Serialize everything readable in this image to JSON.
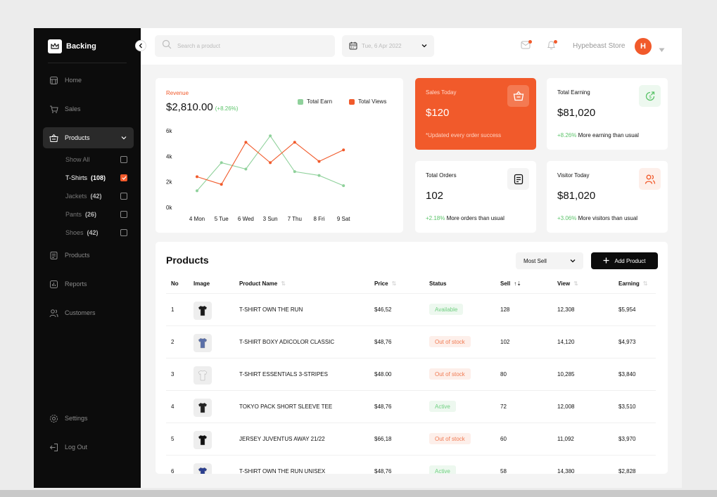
{
  "sidebar": {
    "brand": "Backing",
    "nav": {
      "home": "Home",
      "sales": "Sales",
      "products": "Products",
      "products2": "Products",
      "reports": "Reports",
      "customers": "Customers",
      "settings": "Settings",
      "logout": "Log Out"
    },
    "subitems": [
      {
        "label": "Show All",
        "count": "",
        "checked": false
      },
      {
        "label": "T-Shirts",
        "count": "(108)",
        "checked": true
      },
      {
        "label": "Jackets",
        "count": "(42)",
        "checked": false
      },
      {
        "label": "Pants",
        "count": "(26)",
        "checked": false
      },
      {
        "label": "Shoes",
        "count": "(42)",
        "checked": false
      }
    ]
  },
  "topbar": {
    "search_placeholder": "Search a product",
    "date": "Tue, 6 Apr 2022",
    "store": "Hypebeast Store",
    "avatar_initial": "H"
  },
  "revenue": {
    "label": "Revenue",
    "value": "$2,810.00",
    "change": "(+8.26%)"
  },
  "chart_data": {
    "type": "line",
    "x": [
      "4 Mon",
      "5 Tue",
      "6 Wed",
      "3 Sun",
      "7 Thu",
      "8 Fri",
      "9 Sat"
    ],
    "y_ticks": [
      "6k",
      "4k",
      "2k",
      "0k"
    ],
    "ylim": [
      0,
      6000
    ],
    "grid": false,
    "legend": "top-right",
    "series": [
      {
        "name": "Total Earn",
        "color": "#8fd19b",
        "values": [
          1300,
          3500,
          3000,
          5600,
          2800,
          2500,
          1700
        ]
      },
      {
        "name": "Total Views",
        "color": "#f15a2b",
        "values": [
          2400,
          1800,
          5100,
          3500,
          5100,
          3600,
          4500
        ]
      }
    ]
  },
  "stats": {
    "sales_today": {
      "title": "Sales Today",
      "value": "$120",
      "note": "*Updated every order success"
    },
    "total_earning": {
      "title": "Total Earning",
      "value": "$81,020",
      "change": "+8.26%",
      "note": "More earning than usual"
    },
    "total_orders": {
      "title": "Total Orders",
      "value": "102",
      "change": "+2.18%",
      "note": "More orders than usual"
    },
    "visitor_today": {
      "title": "Visitor Today",
      "value": "$81,020",
      "change": "+3.06%",
      "note": "More visitors than usual"
    }
  },
  "products": {
    "title": "Products",
    "sort_label": "Most Sell",
    "add_label": "Add Product",
    "columns": [
      "No",
      "Image",
      "Product Name",
      "Price",
      "Status",
      "Sell",
      "View",
      "Earning"
    ],
    "rows": [
      {
        "no": "1",
        "name": "T-SHIRT OWN THE RUN",
        "price": "$46,52",
        "status": "Available",
        "sell": "128",
        "view": "12,308",
        "earning": "$5,954",
        "tone": "green",
        "shirt": "#1a1a1a"
      },
      {
        "no": "2",
        "name": "T-SHIRT BOXY ADICOLOR CLASSIC",
        "price": "$48,76",
        "status": "Out of stock",
        "sell": "102",
        "view": "14,120",
        "earning": "$4,973",
        "tone": "red",
        "shirt": "#5a6fa8"
      },
      {
        "no": "3",
        "name": "T-SHIRT ESSENTIALS 3-STRIPES",
        "price": "$48.00",
        "status": "Out of stock",
        "sell": "80",
        "view": "10,285",
        "earning": "$3,840",
        "tone": "red",
        "shirt": "#f2f2f2"
      },
      {
        "no": "4",
        "name": "TOKYO PACK SHORT SLEEVE TEE",
        "price": "$48,76",
        "status": "Active",
        "sell": "72",
        "view": "12,008",
        "earning": "$3,510",
        "tone": "green",
        "shirt": "#222222"
      },
      {
        "no": "5",
        "name": "JERSEY JUVENTUS AWAY 21/22",
        "price": "$66,18",
        "status": "Out of stock",
        "sell": "60",
        "view": "11,092",
        "earning": "$3,970",
        "tone": "red",
        "shirt": "#111111"
      },
      {
        "no": "6",
        "name": "T-SHIRT OWN THE RUN UNISEX",
        "price": "$48,76",
        "status": "Active",
        "sell": "58",
        "view": "14,380",
        "earning": "$2,828",
        "tone": "green",
        "shirt": "#2b3f8f"
      }
    ]
  }
}
